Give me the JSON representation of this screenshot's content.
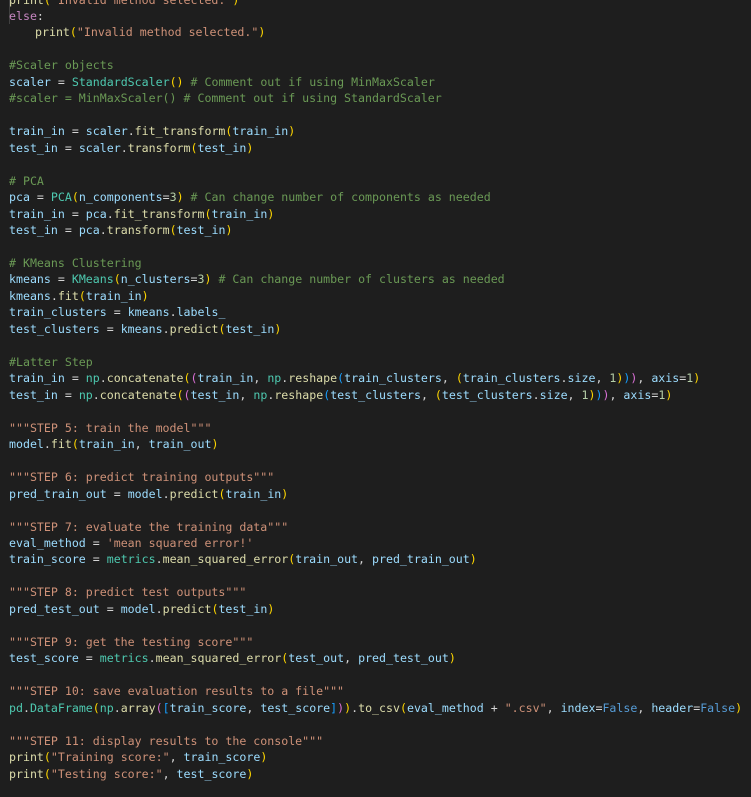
{
  "editor": {
    "language": "python",
    "lines": [
      [
        [
          "f",
          "print"
        ],
        [
          "p1",
          "("
        ],
        [
          "s",
          "\"Invalid method selected.\""
        ],
        [
          "p1",
          ")"
        ]
      ],
      [
        [
          "k",
          "else"
        ],
        [
          "o",
          ":"
        ]
      ],
      [
        [
          "indent",
          ""
        ],
        [
          "f",
          "print"
        ],
        [
          "p1",
          "("
        ],
        [
          "s",
          "\"Invalid method selected.\""
        ],
        [
          "p1",
          ")"
        ]
      ],
      [],
      [
        [
          "c",
          "#Scaler objects"
        ]
      ],
      [
        [
          "v",
          "scaler"
        ],
        [
          "o",
          " = "
        ],
        [
          "t",
          "StandardScaler"
        ],
        [
          "p1",
          "()"
        ],
        [
          "o",
          " "
        ],
        [
          "c",
          "# Comment out if using MinMaxScaler"
        ]
      ],
      [
        [
          "c",
          "#scaler = MinMaxScaler() # Comment out if using StandardScaler"
        ]
      ],
      [],
      [
        [
          "v",
          "train_in"
        ],
        [
          "o",
          " = "
        ],
        [
          "v",
          "scaler"
        ],
        [
          "o",
          "."
        ],
        [
          "f",
          "fit_transform"
        ],
        [
          "p1",
          "("
        ],
        [
          "v",
          "train_in"
        ],
        [
          "p1",
          ")"
        ]
      ],
      [
        [
          "v",
          "test_in"
        ],
        [
          "o",
          " = "
        ],
        [
          "v",
          "scaler"
        ],
        [
          "o",
          "."
        ],
        [
          "f",
          "transform"
        ],
        [
          "p1",
          "("
        ],
        [
          "v",
          "test_in"
        ],
        [
          "p1",
          ")"
        ]
      ],
      [],
      [
        [
          "c",
          "# PCA"
        ]
      ],
      [
        [
          "v",
          "pca"
        ],
        [
          "o",
          " = "
        ],
        [
          "t",
          "PCA"
        ],
        [
          "p1",
          "("
        ],
        [
          "v",
          "n_components"
        ],
        [
          "o",
          "="
        ],
        [
          "n",
          "3"
        ],
        [
          "p1",
          ")"
        ],
        [
          "o",
          " "
        ],
        [
          "c",
          "# Can change number of components as needed"
        ]
      ],
      [
        [
          "v",
          "train_in"
        ],
        [
          "o",
          " = "
        ],
        [
          "v",
          "pca"
        ],
        [
          "o",
          "."
        ],
        [
          "f",
          "fit_transform"
        ],
        [
          "p1",
          "("
        ],
        [
          "v",
          "train_in"
        ],
        [
          "p1",
          ")"
        ]
      ],
      [
        [
          "v",
          "test_in"
        ],
        [
          "o",
          " = "
        ],
        [
          "v",
          "pca"
        ],
        [
          "o",
          "."
        ],
        [
          "f",
          "transform"
        ],
        [
          "p1",
          "("
        ],
        [
          "v",
          "test_in"
        ],
        [
          "p1",
          ")"
        ]
      ],
      [],
      [
        [
          "c",
          "# KMeans Clustering"
        ]
      ],
      [
        [
          "v",
          "kmeans"
        ],
        [
          "o",
          " = "
        ],
        [
          "t",
          "KMeans"
        ],
        [
          "p1",
          "("
        ],
        [
          "v",
          "n_clusters"
        ],
        [
          "o",
          "="
        ],
        [
          "n",
          "3"
        ],
        [
          "p1",
          ")"
        ],
        [
          "o",
          " "
        ],
        [
          "c",
          "# Can change number of clusters as needed"
        ]
      ],
      [
        [
          "v",
          "kmeans"
        ],
        [
          "o",
          "."
        ],
        [
          "f",
          "fit"
        ],
        [
          "p1",
          "("
        ],
        [
          "v",
          "train_in"
        ],
        [
          "p1",
          ")"
        ]
      ],
      [
        [
          "v",
          "train_clusters"
        ],
        [
          "o",
          " = "
        ],
        [
          "v",
          "kmeans"
        ],
        [
          "o",
          "."
        ],
        [
          "v",
          "labels_"
        ]
      ],
      [
        [
          "v",
          "test_clusters"
        ],
        [
          "o",
          " = "
        ],
        [
          "v",
          "kmeans"
        ],
        [
          "o",
          "."
        ],
        [
          "f",
          "predict"
        ],
        [
          "p1",
          "("
        ],
        [
          "v",
          "test_in"
        ],
        [
          "p1",
          ")"
        ]
      ],
      [],
      [
        [
          "c",
          "#Latter Step"
        ]
      ],
      [
        [
          "v",
          "train_in"
        ],
        [
          "o",
          " = "
        ],
        [
          "t",
          "np"
        ],
        [
          "o",
          "."
        ],
        [
          "f",
          "concatenate"
        ],
        [
          "p1",
          "("
        ],
        [
          "p2",
          "("
        ],
        [
          "v",
          "train_in"
        ],
        [
          "o",
          ", "
        ],
        [
          "t",
          "np"
        ],
        [
          "o",
          "."
        ],
        [
          "f",
          "reshape"
        ],
        [
          "p3",
          "("
        ],
        [
          "v",
          "train_clusters"
        ],
        [
          "o",
          ", "
        ],
        [
          "p1",
          "("
        ],
        [
          "v",
          "train_clusters"
        ],
        [
          "o",
          "."
        ],
        [
          "v",
          "size"
        ],
        [
          "o",
          ", "
        ],
        [
          "n",
          "1"
        ],
        [
          "p1",
          ")"
        ],
        [
          "p3",
          ")"
        ],
        [
          "p2",
          ")"
        ],
        [
          "o",
          ", "
        ],
        [
          "v",
          "axis"
        ],
        [
          "o",
          "="
        ],
        [
          "n",
          "1"
        ],
        [
          "p1",
          ")"
        ]
      ],
      [
        [
          "v",
          "test_in"
        ],
        [
          "o",
          " = "
        ],
        [
          "t",
          "np"
        ],
        [
          "o",
          "."
        ],
        [
          "f",
          "concatenate"
        ],
        [
          "p1",
          "("
        ],
        [
          "p2",
          "("
        ],
        [
          "v",
          "test_in"
        ],
        [
          "o",
          ", "
        ],
        [
          "t",
          "np"
        ],
        [
          "o",
          "."
        ],
        [
          "f",
          "reshape"
        ],
        [
          "p3",
          "("
        ],
        [
          "v",
          "test_clusters"
        ],
        [
          "o",
          ", "
        ],
        [
          "p1",
          "("
        ],
        [
          "v",
          "test_clusters"
        ],
        [
          "o",
          "."
        ],
        [
          "v",
          "size"
        ],
        [
          "o",
          ", "
        ],
        [
          "n",
          "1"
        ],
        [
          "p1",
          ")"
        ],
        [
          "p3",
          ")"
        ],
        [
          "p2",
          ")"
        ],
        [
          "o",
          ", "
        ],
        [
          "v",
          "axis"
        ],
        [
          "o",
          "="
        ],
        [
          "n",
          "1"
        ],
        [
          "p1",
          ")"
        ]
      ],
      [],
      [
        [
          "s",
          "\"\"\"STEP 5: train the model\"\"\""
        ]
      ],
      [
        [
          "v",
          "model"
        ],
        [
          "o",
          "."
        ],
        [
          "f",
          "fit"
        ],
        [
          "p1",
          "("
        ],
        [
          "v",
          "train_in"
        ],
        [
          "o",
          ", "
        ],
        [
          "v",
          "train_out"
        ],
        [
          "p1",
          ")"
        ]
      ],
      [],
      [
        [
          "s",
          "\"\"\"STEP 6: predict training outputs\"\"\""
        ]
      ],
      [
        [
          "v",
          "pred_train_out"
        ],
        [
          "o",
          " = "
        ],
        [
          "v",
          "model"
        ],
        [
          "o",
          "."
        ],
        [
          "f",
          "predict"
        ],
        [
          "p1",
          "("
        ],
        [
          "v",
          "train_in"
        ],
        [
          "p1",
          ")"
        ]
      ],
      [],
      [
        [
          "s",
          "\"\"\"STEP 7: evaluate the training data\"\"\""
        ]
      ],
      [
        [
          "v",
          "eval_method"
        ],
        [
          "o",
          " = "
        ],
        [
          "s",
          "'mean squared error!'"
        ]
      ],
      [
        [
          "v",
          "train_score"
        ],
        [
          "o",
          " = "
        ],
        [
          "t",
          "metrics"
        ],
        [
          "o",
          "."
        ],
        [
          "f",
          "mean_squared_error"
        ],
        [
          "p1",
          "("
        ],
        [
          "v",
          "train_out"
        ],
        [
          "o",
          ", "
        ],
        [
          "v",
          "pred_train_out"
        ],
        [
          "p1",
          ")"
        ]
      ],
      [],
      [
        [
          "s",
          "\"\"\"STEP 8: predict test outputs\"\"\""
        ]
      ],
      [
        [
          "v",
          "pred_test_out"
        ],
        [
          "o",
          " = "
        ],
        [
          "v",
          "model"
        ],
        [
          "o",
          "."
        ],
        [
          "f",
          "predict"
        ],
        [
          "p1",
          "("
        ],
        [
          "v",
          "test_in"
        ],
        [
          "p1",
          ")"
        ]
      ],
      [],
      [
        [
          "s",
          "\"\"\"STEP 9: get the testing score\"\"\""
        ]
      ],
      [
        [
          "v",
          "test_score"
        ],
        [
          "o",
          " = "
        ],
        [
          "t",
          "metrics"
        ],
        [
          "o",
          "."
        ],
        [
          "f",
          "mean_squared_error"
        ],
        [
          "p1",
          "("
        ],
        [
          "v",
          "test_out"
        ],
        [
          "o",
          ", "
        ],
        [
          "v",
          "pred_test_out"
        ],
        [
          "p1",
          ")"
        ]
      ],
      [],
      [
        [
          "s",
          "\"\"\"STEP 10: save evaluation results to a file\"\"\""
        ]
      ],
      [
        [
          "t",
          "pd"
        ],
        [
          "o",
          "."
        ],
        [
          "t",
          "DataFrame"
        ],
        [
          "p1",
          "("
        ],
        [
          "t",
          "np"
        ],
        [
          "o",
          "."
        ],
        [
          "f",
          "array"
        ],
        [
          "p2",
          "("
        ],
        [
          "p3",
          "["
        ],
        [
          "v",
          "train_score"
        ],
        [
          "o",
          ", "
        ],
        [
          "v",
          "test_score"
        ],
        [
          "p3",
          "]"
        ],
        [
          "p2",
          ")"
        ],
        [
          "p1",
          ")"
        ],
        [
          "o",
          "."
        ],
        [
          "f",
          "to_csv"
        ],
        [
          "p1",
          "("
        ],
        [
          "v",
          "eval_method"
        ],
        [
          "o",
          " + "
        ],
        [
          "s",
          "\".csv\""
        ],
        [
          "o",
          ", "
        ],
        [
          "v",
          "index"
        ],
        [
          "o",
          "="
        ],
        [
          "b",
          "False"
        ],
        [
          "o",
          ", "
        ],
        [
          "v",
          "header"
        ],
        [
          "o",
          "="
        ],
        [
          "b",
          "False"
        ],
        [
          "p1",
          ")"
        ]
      ],
      [],
      [
        [
          "s",
          "\"\"\"STEP 11: display results to the console\"\"\""
        ]
      ],
      [
        [
          "f",
          "print"
        ],
        [
          "p1",
          "("
        ],
        [
          "s",
          "\"Training score:\""
        ],
        [
          "o",
          ", "
        ],
        [
          "v",
          "train_score"
        ],
        [
          "p1",
          ")"
        ]
      ],
      [
        [
          "f",
          "print"
        ],
        [
          "p1",
          "("
        ],
        [
          "s",
          "\"Testing score:\""
        ],
        [
          "o",
          ", "
        ],
        [
          "v",
          "test_score"
        ],
        [
          "p1",
          ")"
        ]
      ],
      []
    ]
  }
}
